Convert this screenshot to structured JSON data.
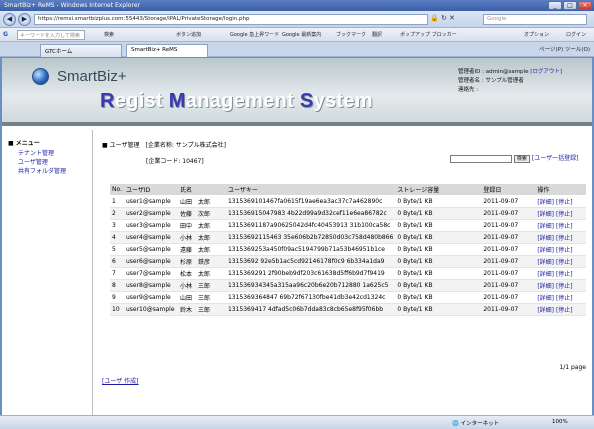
{
  "window": {
    "title": "SmartBiz+ ReMS - Windows Internet Explorer"
  },
  "browser": {
    "url": "https://remsi.smartbizplus.com:55443/Storage/IPAL/PrivateStorage/login.php",
    "web_search_placeholder": "Google",
    "google_search_placeholder": "キーワードを入力して検索",
    "toolbar_search_label": "検索",
    "toolbar_items": [
      "ボタン追加",
      "Google 急上昇ワード",
      "Google 最新案内",
      "ブックマーク",
      "翻訳",
      "ポップアップ ブロッカー",
      "オプション"
    ],
    "login_label": "ログイン",
    "tabs": [
      "GTCホーム",
      "SmartBiz+ ReMS"
    ],
    "command_items": [
      "ページ(P)",
      "ツール(O)"
    ],
    "status_left": "",
    "status_zone": "インターネット",
    "status_zoom": "100%"
  },
  "header": {
    "brand": "SmartBiz+",
    "system_R": "R",
    "system_1": "egist ",
    "system_M": "M",
    "system_2": "anagement ",
    "system_S": "S",
    "system_3": "ystem",
    "admin_id_label": "管理者ID",
    "admin_id": "admin@sample",
    "logout_label": "[ログアウト]",
    "admin_name_label": "管理者名",
    "admin_name": "サンプル管理者",
    "contact_label": "連絡先",
    "contact_value": ""
  },
  "sidebar": {
    "menu_title": "メニュー",
    "items": [
      {
        "label": "テナント管理"
      },
      {
        "label": "ユーザ管理"
      },
      {
        "label": "共有フォルダ管理"
      }
    ]
  },
  "main": {
    "section_title": "ユーザ管理",
    "company_label": "[企業名称: サンプル株式会社]",
    "company_code_label": "[企業コード: 10467]",
    "search_value": "",
    "search_button": "検索",
    "bulk_register": "[ユーザ一括登録]",
    "columns": [
      "No.",
      "ユーザID",
      "氏名",
      "ユーザキー",
      "ストレージ容量",
      "登録日",
      "操作"
    ],
    "rows": [
      {
        "no": "1",
        "id": "user1@sample",
        "name": "山田　太郎",
        "key": "1315369101467fa0615f19ae6ea3ac37c7a462890c",
        "storage": "0 Byte/1 KB",
        "date": "2011-09-07",
        "detail": "[詳細]",
        "stop": "[停止]"
      },
      {
        "no": "2",
        "id": "user2@sample",
        "name": "佐藤　次郎",
        "key": "131536915047983 4b22d99a9d32cef11e6ea86782c",
        "storage": "0 Byte/1 KB",
        "date": "2011-09-07",
        "detail": "[詳細]",
        "stop": "[停止]"
      },
      {
        "no": "3",
        "id": "user3@sample",
        "name": "田中　太郎",
        "key": "13153691187a90625042d4fc40453913 31b100ca58c",
        "storage": "0 Byte/1 KB",
        "date": "2011-09-07",
        "detail": "[詳細]",
        "stop": "[停止]"
      },
      {
        "no": "4",
        "id": "user4@sample",
        "name": "小林　太郎",
        "key": "13153692115463 35e606b2b72850d03c758d480b866",
        "storage": "0 Byte/1 KB",
        "date": "2011-09-07",
        "detail": "[詳細]",
        "stop": "[停止]"
      },
      {
        "no": "5",
        "id": "user5@sample",
        "name": "遠藤　太郎",
        "key": "1315369253a450f09ac5194799b71a53b46951b1ce",
        "storage": "0 Byte/1 KB",
        "date": "2011-09-07",
        "detail": "[詳細]",
        "stop": "[停止]"
      },
      {
        "no": "6",
        "id": "user6@sample",
        "name": "杉原　鉄彦",
        "key": "13153692 92e5b1ac5cd92146178f0c9 6b334a1da9",
        "storage": "0 Byte/1 KB",
        "date": "2011-09-07",
        "detail": "[詳細]",
        "stop": "[停止]"
      },
      {
        "no": "7",
        "id": "user7@sample",
        "name": "松本　太郎",
        "key": "1315369291 2f90beb9df203c61638d5ff6b9d7f9419",
        "storage": "0 Byte/1 KB",
        "date": "2011-09-07",
        "detail": "[詳細]",
        "stop": "[停止]"
      },
      {
        "no": "8",
        "id": "user8@sample",
        "name": "小林　三郎",
        "key": "131536934345a315aa96c20b6e20b712880 1a625c5",
        "storage": "0 Byte/1 KB",
        "date": "2011-09-07",
        "detail": "[詳細]",
        "stop": "[停止]"
      },
      {
        "no": "9",
        "id": "user9@sample",
        "name": "山田　三郎",
        "key": "1315369364847 69b72f67130fbe41db3e42cd1324c",
        "storage": "0 Byte/1 KB",
        "date": "2011-09-07",
        "detail": "[詳細]",
        "stop": "[停止]"
      },
      {
        "no": "10",
        "id": "user10@sample",
        "name": "鈴木　三郎",
        "key": "1315369417 4dfad5c06b7dda83c8cb65e8f95f06bb",
        "storage": "0 Byte/1 KB",
        "date": "2011-09-07",
        "detail": "[詳細]",
        "stop": "[停止]"
      }
    ],
    "paging": "1/1 page",
    "create_link": "[ユーザ 作成]"
  }
}
